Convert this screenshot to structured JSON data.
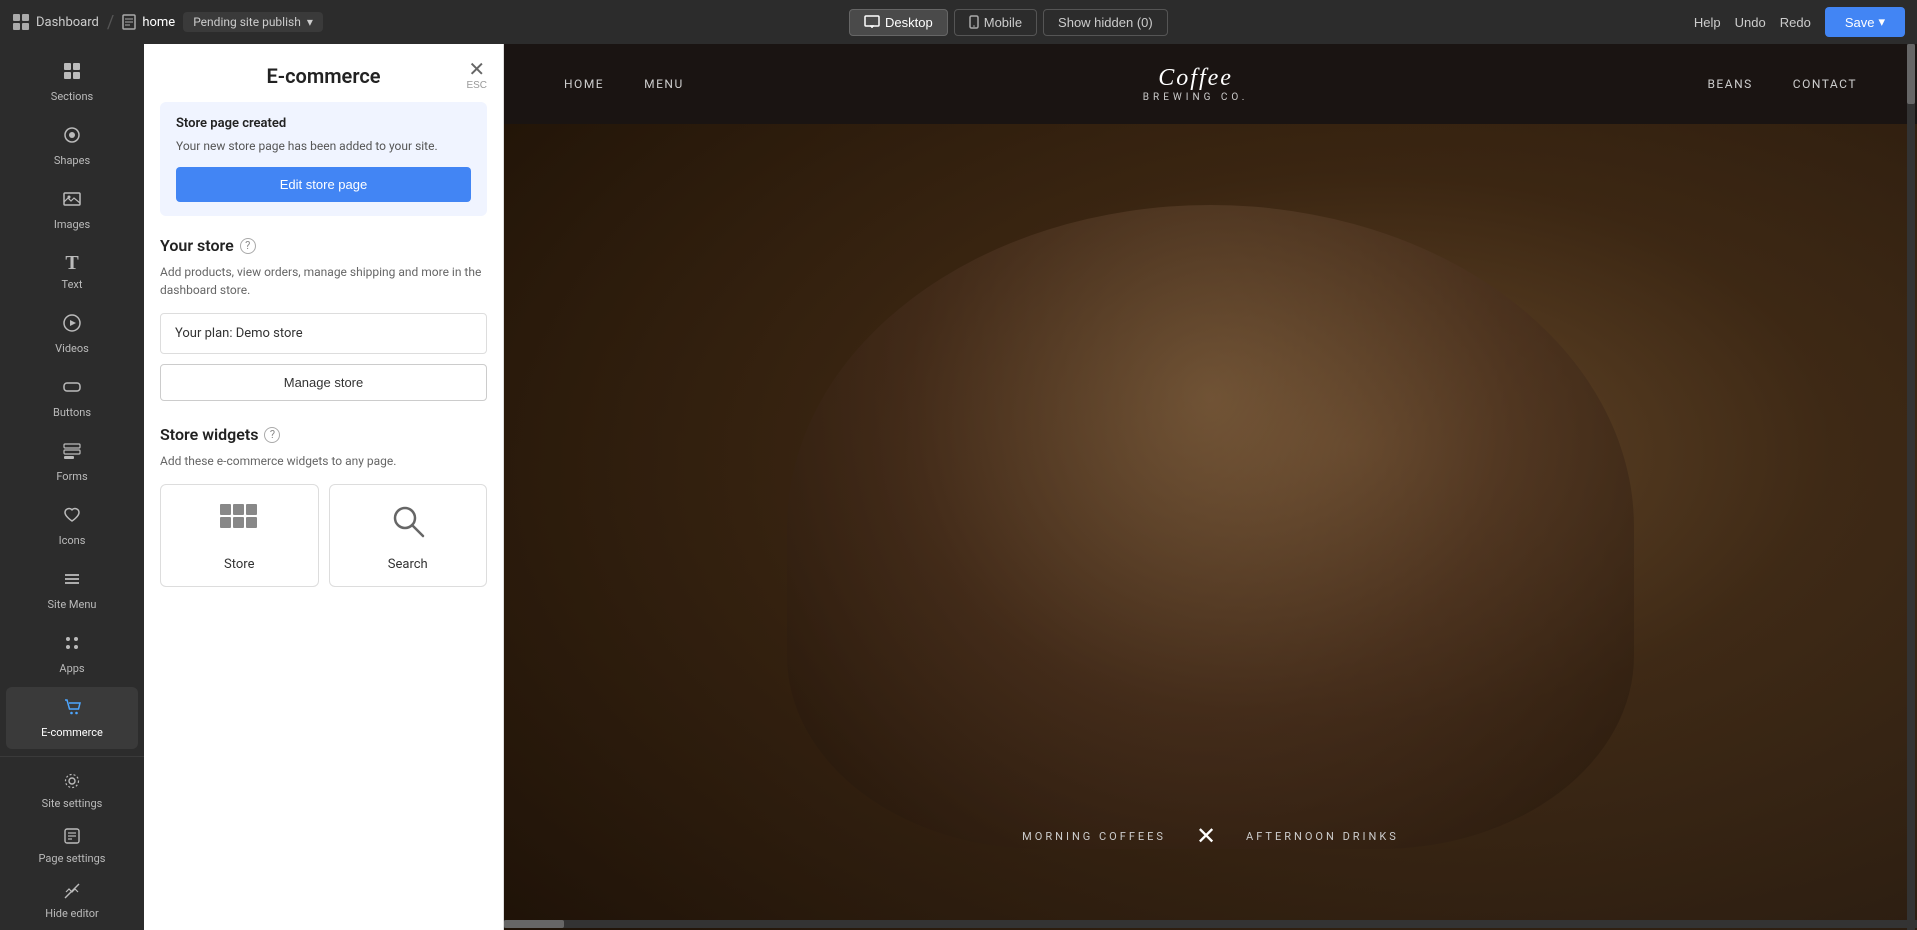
{
  "topbar": {
    "brand_label": "Dashboard",
    "page_label": "home",
    "pending_label": "Pending site publish",
    "view_desktop": "Desktop",
    "view_mobile": "Mobile",
    "show_hidden": "Show hidden (0)",
    "help": "Help",
    "undo": "Undo",
    "redo": "Redo",
    "save": "Save"
  },
  "sidebar": {
    "items": [
      {
        "id": "sections",
        "label": "Sections",
        "icon": "⊞"
      },
      {
        "id": "shapes",
        "label": "Shapes",
        "icon": "◉"
      },
      {
        "id": "images",
        "label": "Images",
        "icon": "🖼"
      },
      {
        "id": "text",
        "label": "Text",
        "icon": "T"
      },
      {
        "id": "videos",
        "label": "Videos",
        "icon": "▶"
      },
      {
        "id": "buttons",
        "label": "Buttons",
        "icon": "⬜"
      },
      {
        "id": "forms",
        "label": "Forms",
        "icon": "☰"
      },
      {
        "id": "icons",
        "label": "Icons",
        "icon": "♡"
      },
      {
        "id": "site-menu",
        "label": "Site Menu",
        "icon": "≡"
      },
      {
        "id": "apps",
        "label": "Apps",
        "icon": "⋮⋮"
      },
      {
        "id": "ecommerce",
        "label": "E-commerce",
        "icon": "🛒"
      }
    ],
    "bottom": [
      {
        "id": "site-settings",
        "label": "Site settings",
        "icon": "⚙"
      },
      {
        "id": "page-settings",
        "label": "Page settings",
        "icon": "⚙"
      },
      {
        "id": "hide-editor",
        "label": "Hide editor",
        "icon": "✏"
      }
    ]
  },
  "panel": {
    "title": "E-commerce",
    "close_label": "ESC",
    "notice": {
      "title": "Store page created",
      "text": "Your new store page has been added to your site.",
      "button": "Edit store page"
    },
    "your_store": {
      "heading": "Your store",
      "desc": "Add products, view orders, manage shipping and more in the dashboard store.",
      "plan_label": "Your plan: Demo store",
      "manage_btn": "Manage store"
    },
    "widgets": {
      "heading": "Store widgets",
      "desc": "Add these e-commerce widgets to any page.",
      "store_label": "Store",
      "search_label": "Search"
    }
  },
  "preview": {
    "nav": {
      "links_left": [
        "HOME",
        "MENU"
      ],
      "logo_text": "Coffee",
      "logo_brand": "BREWING CO.",
      "links_right": [
        "BEANS",
        "CONTACT"
      ]
    },
    "hero": {
      "tab_left": "MORNING COFFEES",
      "tab_right": "AFTERNOON DRINKS"
    }
  }
}
